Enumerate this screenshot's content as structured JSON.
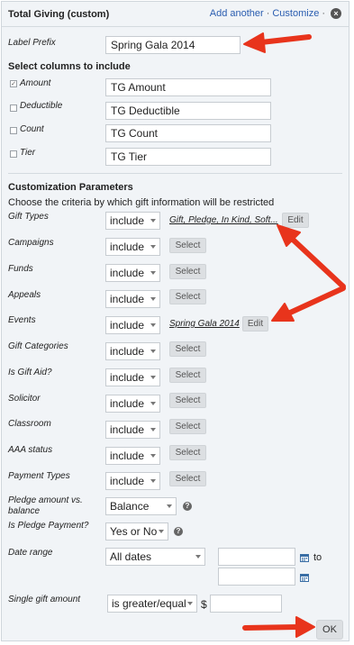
{
  "header": {
    "title": "Total Giving (custom)",
    "add_another": "Add another",
    "separator": "·",
    "customize": "Customize",
    "close_glyph": "×"
  },
  "label_prefix": {
    "label": "Label Prefix",
    "value": "Spring Gala 2014"
  },
  "columns": {
    "heading": "Select columns to include",
    "items": [
      {
        "label": "Amount",
        "checked": true,
        "value": "TG Amount"
      },
      {
        "label": "Deductible",
        "checked": false,
        "value": "TG Deductible"
      },
      {
        "label": "Count",
        "checked": false,
        "value": "TG Count"
      },
      {
        "label": "Tier",
        "checked": false,
        "value": "TG Tier"
      }
    ]
  },
  "params": {
    "heading": "Customization Parameters",
    "description": "Choose the criteria by which gift information will be restricted",
    "rows": [
      {
        "label": "Gift Types",
        "mode": "include",
        "link": "Gift, Pledge, In Kind, Soft...",
        "button": "Edit"
      },
      {
        "label": "Campaigns",
        "mode": "include",
        "button": "Select"
      },
      {
        "label": "Funds",
        "mode": "include",
        "button": "Select"
      },
      {
        "label": "Appeals",
        "mode": "include",
        "button": "Select"
      },
      {
        "label": "Events",
        "mode": "include",
        "link": "Spring Gala 2014",
        "button": "Edit"
      },
      {
        "label": "Gift Categories",
        "mode": "include",
        "button": "Select"
      },
      {
        "label": "Is Gift Aid?",
        "mode": "include",
        "button": "Select"
      },
      {
        "label": "Solicitor",
        "mode": "include",
        "button": "Select"
      },
      {
        "label": "Classroom",
        "mode": "include",
        "button": "Select"
      },
      {
        "label": "AAA status",
        "mode": "include",
        "button": "Select"
      },
      {
        "label": "Payment Types",
        "mode": "include",
        "button": "Select"
      }
    ],
    "pledge_vs_balance": {
      "label_line1": "Pledge amount vs.",
      "label_line2": "balance",
      "value": "Balance"
    },
    "is_pledge_payment": {
      "label": "Is Pledge Payment?",
      "value": "Yes or No"
    },
    "date_range": {
      "label": "Date range",
      "value": "All dates",
      "to": "to",
      "from_value": "",
      "to_value": ""
    },
    "single_gift": {
      "label": "Single gift amount",
      "operator": "is greater/equal",
      "currency": "$",
      "value": ""
    },
    "help_glyph": "?"
  },
  "ok_label": "OK",
  "colors": {
    "annotation_arrow": "#e8341c",
    "link": "#2a5db0",
    "panel_bg": "#f1f4f7",
    "button_bg": "#dcdfe2"
  },
  "icons": {
    "close": "close-icon",
    "help": "help-icon",
    "calendar": "calendar-icon",
    "checkbox": "checkbox"
  }
}
